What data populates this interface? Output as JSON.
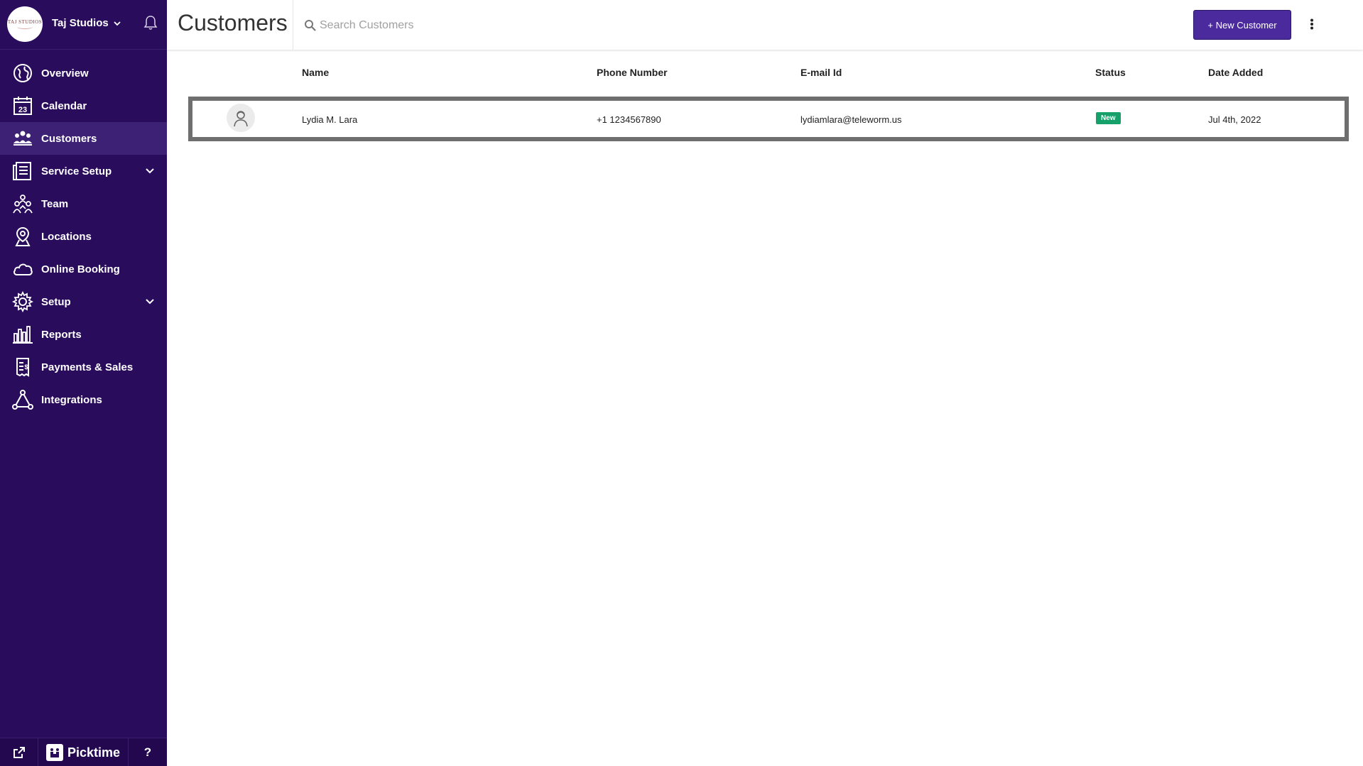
{
  "brand": {
    "logo_text": "TAJ STUDIOS",
    "name": "Taj Studios"
  },
  "nav": {
    "items": [
      {
        "label": "Overview",
        "icon": "globe-icon"
      },
      {
        "label": "Calendar",
        "icon": "calendar-icon",
        "icon_text": "23"
      },
      {
        "label": "Customers",
        "icon": "customers-icon",
        "active": true
      },
      {
        "label": "Service Setup",
        "icon": "service-list-icon",
        "has_submenu": true
      },
      {
        "label": "Team",
        "icon": "team-icon"
      },
      {
        "label": "Locations",
        "icon": "location-pin-icon"
      },
      {
        "label": "Online Booking",
        "icon": "cloud-icon"
      },
      {
        "label": "Setup",
        "icon": "gear-icon",
        "has_submenu": true
      },
      {
        "label": "Reports",
        "icon": "bar-chart-icon"
      },
      {
        "label": "Payments & Sales",
        "icon": "receipt-icon"
      },
      {
        "label": "Integrations",
        "icon": "integrations-icon"
      }
    ]
  },
  "footer": {
    "logo_text": "Picktime",
    "help_label": "?"
  },
  "header": {
    "title": "Customers",
    "search_placeholder": "Search Customers",
    "new_button_label": "+ New Customer"
  },
  "table": {
    "columns": [
      "Name",
      "Phone Number",
      "E-mail Id",
      "Status",
      "Date Added"
    ],
    "rows": [
      {
        "name": "Lydia M. Lara",
        "phone": "+1 1234567890",
        "email": "lydiamlara@teleworm.us",
        "status": "New",
        "date_added": "Jul 4th, 2022"
      }
    ]
  },
  "colors": {
    "sidebar_bg": "#2a0c5c",
    "sidebar_active": "#3c2175",
    "primary_button": "#4a2a9c",
    "status_new": "#16a06a"
  }
}
